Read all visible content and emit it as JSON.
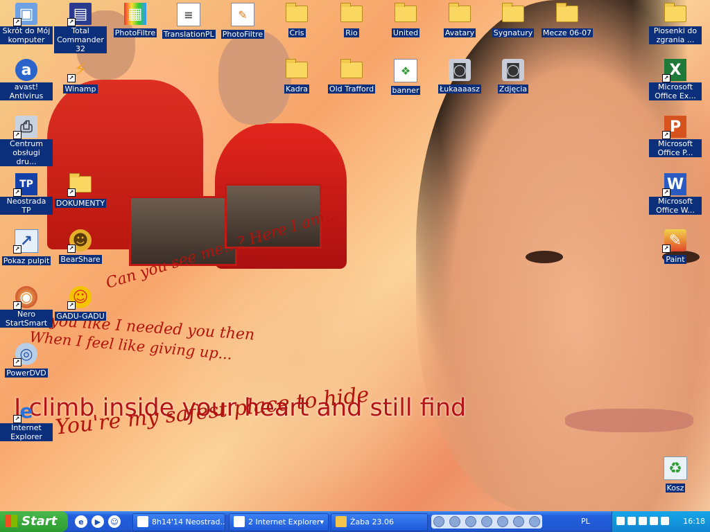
{
  "desktop": {
    "icons": [
      {
        "label": "Skrót do Mój komputer",
        "glyph": "my-computer-icon"
      },
      {
        "label": "avast! Antivirus",
        "glyph": "avast-icon"
      },
      {
        "label": "Centrum obsługi dru...",
        "glyph": "printer-icon"
      },
      {
        "label": "Neostrada TP",
        "glyph": "tp-icon"
      },
      {
        "label": "Pokaz pulpit",
        "glyph": "show-desktop-icon"
      },
      {
        "label": "Nero StartSmart",
        "glyph": "nero-icon"
      },
      {
        "label": "PowerDVD",
        "glyph": "dvd-icon"
      },
      {
        "label": "Internet Explorer",
        "glyph": "ie-icon"
      },
      {
        "label": "Total Commander 32",
        "glyph": "floppy-icon"
      },
      {
        "label": "Winamp",
        "glyph": "winamp-icon"
      },
      {
        "label": "DOKUMENTY",
        "glyph": "folder-icon"
      },
      {
        "label": "BearShare",
        "glyph": "bearshare-icon"
      },
      {
        "label": "GADU-GADU",
        "glyph": "gadugadu-icon"
      },
      {
        "label": "PhotoFiltre",
        "glyph": "photofiltre-icon"
      },
      {
        "label": "TranslationPL",
        "glyph": "document-icon"
      },
      {
        "label": "PhotoFiltre",
        "glyph": "photofiltre-icon"
      },
      {
        "label": "Cris",
        "glyph": "folder-icon"
      },
      {
        "label": "Kadra",
        "glyph": "folder-icon"
      },
      {
        "label": "Rio",
        "glyph": "folder-icon"
      },
      {
        "label": "Old Trafford",
        "glyph": "folder-icon"
      },
      {
        "label": "United",
        "glyph": "folder-icon"
      },
      {
        "label": "banner",
        "glyph": "image-icon"
      },
      {
        "label": "Avatary",
        "glyph": "folder-icon"
      },
      {
        "label": "Łukaaaasz",
        "glyph": "camera-icon"
      },
      {
        "label": "Sygnatury",
        "glyph": "folder-icon"
      },
      {
        "label": "Zdjęcia",
        "glyph": "camera-icon"
      },
      {
        "label": "Mecze 06-07",
        "glyph": "folder-icon"
      },
      {
        "label": "Piosenki do zgrania ...",
        "glyph": "folder-icon"
      },
      {
        "label": "Microsoft Office Ex...",
        "glyph": "excel-icon"
      },
      {
        "label": "Microsoft Office P...",
        "glyph": "powerpoint-icon"
      },
      {
        "label": "Microsoft Office W...",
        "glyph": "word-icon"
      },
      {
        "label": "Paint",
        "glyph": "paint-icon"
      },
      {
        "label": "Kosz",
        "glyph": "recycle-bin-icon"
      }
    ],
    "wallpaper_text": [
      "Can you see me...? Here I am...",
      "ed you like I needed you then",
      "When I feel like giving up...",
      "I climb inside your heart and still find",
      "You're my safest place to hide"
    ]
  },
  "taskbar": {
    "start_label": "Start",
    "tasks": [
      {
        "label": "8h14'14 Neostrad..."
      },
      {
        "label": "2 Internet Explorer"
      },
      {
        "label": "Żaba 23.06"
      }
    ],
    "language": "PL",
    "clock": "16:18"
  },
  "colors": {
    "icon_label_bg": "#0c2f7b",
    "taskbar": "#245edb",
    "start": "#2c9c31",
    "tray": "#0f86d0"
  }
}
